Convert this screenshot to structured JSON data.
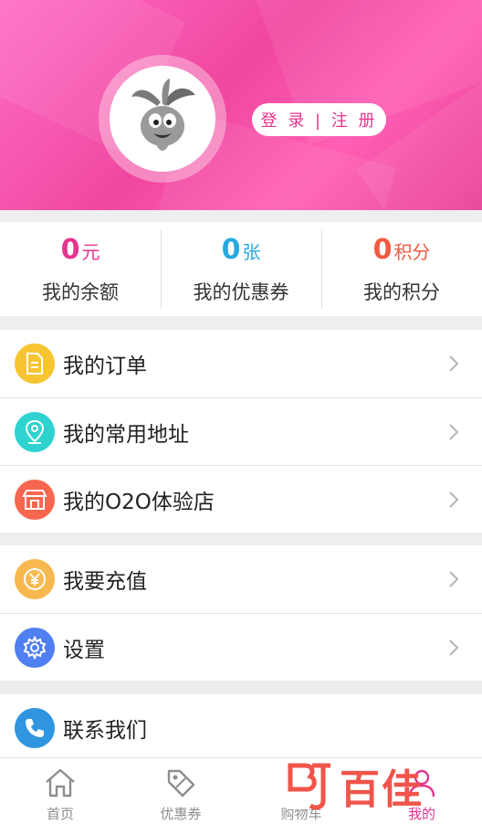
{
  "header": {
    "login_label": "登 录 | 注 册",
    "avatar_icon": "radish-mascot-icon"
  },
  "stats": [
    {
      "value": "0",
      "unit": "元",
      "label": "我的余额",
      "color": "#e4358f"
    },
    {
      "value": "0",
      "unit": "张",
      "label": "我的优惠券",
      "color": "#26a9e0"
    },
    {
      "value": "0",
      "unit": "积分",
      "label": "我的积分",
      "color": "#f15a40"
    }
  ],
  "menu_group_1": [
    {
      "label": "我的订单",
      "icon": "document-icon",
      "color": "#f7c531"
    },
    {
      "label": "我的常用地址",
      "icon": "location-pin-icon",
      "color": "#2ed3d0"
    },
    {
      "label": "我的O2O体验店",
      "icon": "store-icon",
      "color": "#f7664f"
    }
  ],
  "menu_group_2": [
    {
      "label": "我要充值",
      "icon": "yen-coin-icon",
      "color": "#f7b84f"
    },
    {
      "label": "设置",
      "icon": "gear-icon",
      "color": "#4f7ff0"
    }
  ],
  "menu_group_3": [
    {
      "label": "联系我们",
      "icon": "phone-icon",
      "color": "#2f95e0"
    }
  ],
  "tabbar": [
    {
      "label": "首页",
      "icon": "home-icon",
      "active": false
    },
    {
      "label": "优惠券",
      "icon": "coupon-tag-icon",
      "active": false
    },
    {
      "label": "购物车",
      "icon": "cart-icon",
      "active": false
    },
    {
      "label": "我的",
      "icon": "user-icon",
      "active": true
    }
  ],
  "watermark": {
    "text": "百佳",
    "mark": "BJ"
  }
}
